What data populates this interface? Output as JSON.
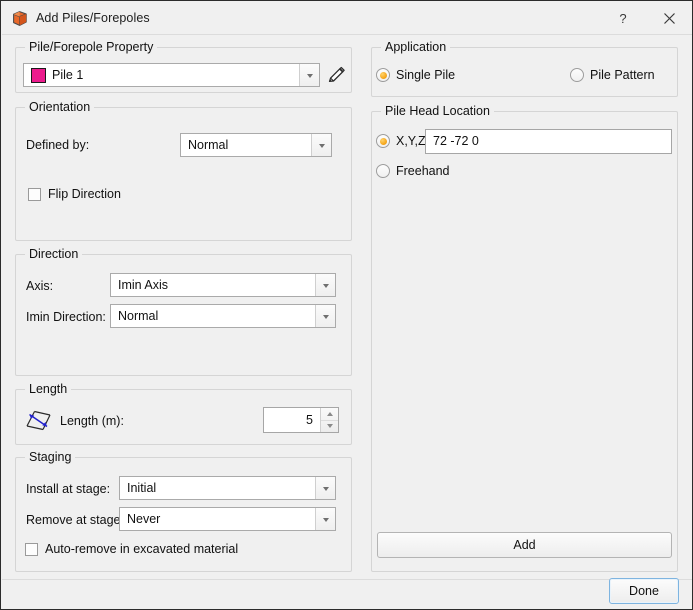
{
  "window": {
    "title": "Add Piles/Forepoles",
    "icon": "pile-box-icon",
    "help_label": "?",
    "close_label": "✕"
  },
  "left": {
    "property_group": {
      "legend": "Pile/Forepole Property",
      "combo_value": "Pile 1",
      "swatch_color": "#ec1b8d",
      "edit_icon": "pencil-icon"
    },
    "orientation_group": {
      "legend": "Orientation",
      "defined_by_label": "Defined by:",
      "defined_by_value": "Normal",
      "flip_direction_label": "Flip Direction",
      "flip_direction_checked": false
    },
    "direction_group": {
      "legend": "Direction",
      "axis_label": "Axis:",
      "axis_value": "Imin Axis",
      "imin_direction_label": "Imin Direction:",
      "imin_direction_value": "Normal"
    },
    "length_group": {
      "legend": "Length",
      "icon": "measure-length-icon",
      "length_label": "Length (m):",
      "length_value": "5"
    },
    "staging_group": {
      "legend": "Staging",
      "install_label": "Install at stage:",
      "install_value": "Initial",
      "remove_label": "Remove at stage:",
      "remove_value": "Never",
      "auto_remove_label": "Auto-remove in excavated material",
      "auto_remove_checked": false
    }
  },
  "right": {
    "application_group": {
      "legend": "Application",
      "single_pile_label": "Single Pile",
      "single_pile_selected": true,
      "pile_pattern_label": "Pile Pattern",
      "pile_pattern_selected": false
    },
    "pile_head_group": {
      "legend": "Pile Head Location",
      "xyz_label": "X,Y,Z",
      "xyz_selected": true,
      "xyz_value": "72 -72 0",
      "freehand_label": "Freehand",
      "freehand_selected": false
    },
    "add_button_label": "Add"
  },
  "footer": {
    "done_button_label": "Done"
  },
  "colors": {
    "accent_radio": "#f6a81e",
    "pile_swatch": "#ec1b8d",
    "window_bg": "#f0f0f0",
    "group_border": "#d5d5d5",
    "focus_border": "#7eb4e0"
  }
}
